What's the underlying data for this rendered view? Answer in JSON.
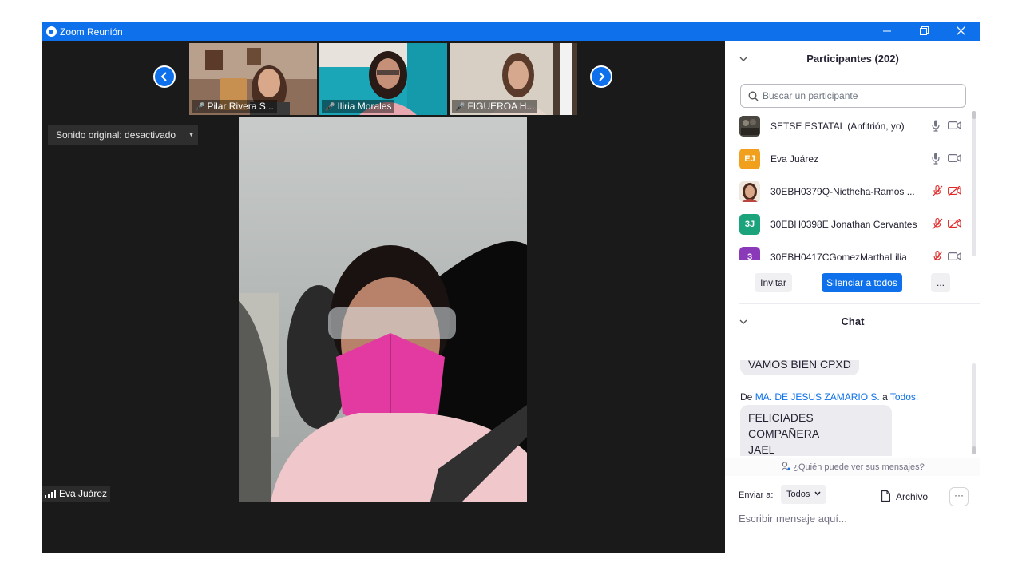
{
  "window": {
    "title": "Zoom Reunión"
  },
  "thumbnails": [
    {
      "name": "Pilar Rivera S..."
    },
    {
      "name": "Iliria Morales"
    },
    {
      "name": "FIGUEROA H..."
    }
  ],
  "sound": {
    "label": "Sonido original: desactivado"
  },
  "main_video": {
    "name": "Eva Juárez"
  },
  "participants": {
    "title": "Participantes (202)",
    "search_placeholder": "Buscar un participante",
    "list": [
      {
        "name": "SETSE ESTATAL (Anfitrión, yo)",
        "avatar_type": "photo",
        "muted": false,
        "video_off": false
      },
      {
        "name": "Eva Juárez",
        "initials": "EJ",
        "avatar_color": "#f0a01c",
        "muted": false,
        "video_off": false
      },
      {
        "name": "30EBH0379Q-Nictheha-Ramos ...",
        "avatar_type": "photo",
        "muted": true,
        "video_off": true
      },
      {
        "name": "30EBH0398E Jonathan Cervantes",
        "initials": "3J",
        "avatar_color": "#1ba37b",
        "muted": true,
        "video_off": true
      },
      {
        "name": "30EBH0417CGomezMarthaLilia",
        "initials": "3",
        "avatar_color": "#8a3ab9",
        "muted": true,
        "video_off": false
      }
    ],
    "buttons": {
      "invite": "Invitar",
      "mute_all": "Silenciar a todos",
      "more": "..."
    }
  },
  "chat": {
    "title": "Chat",
    "messages": [
      {
        "text": "VAMOS BIEN CPXD"
      },
      {
        "from_prefix": "De",
        "sender": "MA. DE JESUS ZAMARIO S.",
        "to_prefix": "a",
        "recipient": "Todos",
        "colon": ":",
        "text_line1": "FELICIADES COMPAÑERA",
        "text_line2": "JAEL"
      }
    ],
    "who_can_see": "¿Quién puede ver sus mensajes?",
    "send_to_label": "Enviar a:",
    "send_to_value": "Todos",
    "file_label": "Archivo",
    "input_placeholder": "Escribir mensaje aquí..."
  },
  "colors": {
    "accent": "#0e71eb",
    "stage_bg": "#1a1a1a",
    "mute_red": "#e02828"
  }
}
